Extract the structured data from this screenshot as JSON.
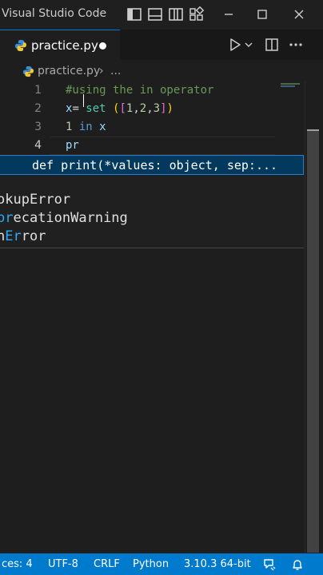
{
  "window": {
    "title": "Visual Studio Code",
    "icons": [
      "toggle-primary-sidebar-icon",
      "toggle-panel-icon",
      "toggle-secondary-sidebar-icon",
      "customize-layout-icon",
      "minimize-icon",
      "maximize-icon",
      "close-icon"
    ]
  },
  "tab": {
    "label": "practice.py",
    "unsaved": true
  },
  "editor_actions": [
    "run-python-file-icon",
    "run-dropdown-chevron-icon",
    "split-editor-icon",
    "more-actions-icon"
  ],
  "breadcrumb": {
    "file": "practice.py",
    "separator": "›",
    "more": "..."
  },
  "code": {
    "lines": [
      {
        "number": "1",
        "tokens": [
          {
            "t": "#using the in operator",
            "k": "comment"
          }
        ]
      },
      {
        "number": "2",
        "tokens": [
          {
            "t": "x",
            "k": "var"
          },
          {
            "t": "= ",
            "k": "plain"
          },
          {
            "t": "set",
            "k": "func"
          },
          {
            "t": " ",
            "k": "plain"
          },
          {
            "t": "(",
            "k": "paren"
          },
          {
            "t": "[",
            "k": "bracket"
          },
          {
            "t": "1",
            "k": "num"
          },
          {
            "t": ",",
            "k": "plain"
          },
          {
            "t": "2",
            "k": "num"
          },
          {
            "t": ",",
            "k": "plain"
          },
          {
            "t": "3",
            "k": "num"
          },
          {
            "t": "]",
            "k": "bracket"
          },
          {
            "t": ")",
            "k": "paren"
          }
        ]
      },
      {
        "number": "3",
        "tokens": [
          {
            "t": "1",
            "k": "num"
          },
          {
            "t": " ",
            "k": "plain"
          },
          {
            "t": "in",
            "k": "kw"
          },
          {
            "t": " ",
            "k": "plain"
          },
          {
            "t": "x",
            "k": "var"
          }
        ]
      },
      {
        "number": "4",
        "tokens": [
          {
            "t": "pr",
            "k": "var"
          }
        ]
      }
    ],
    "active_line": 4
  },
  "signature_help": "def print(*values: object, sep:...",
  "suggestions": [
    {
      "before": "o",
      "match": "",
      "after": "kupError"
    },
    {
      "before": "",
      "match": "pr",
      "after": "ecationWarning"
    },
    {
      "before": "n",
      "match": "Er",
      "after": "ror"
    }
  ],
  "statusbar": {
    "indent": "ces: 4",
    "encoding": "UTF-8",
    "eol": "CRLF",
    "language": "Python",
    "interpreter": "3.10.3 64-bit",
    "icons": [
      "feedback-icon",
      "notifications-bell-icon"
    ]
  },
  "colors": {
    "statusbar": "#007acc",
    "tab_accent": "#0078d4",
    "signature_bg": "#04395e",
    "match_highlight": "#2aaaff"
  }
}
